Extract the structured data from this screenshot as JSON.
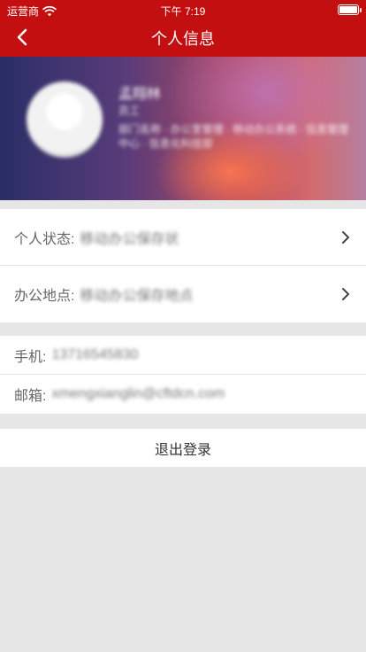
{
  "status": {
    "carrier": "运营商",
    "time": "下午 7:19"
  },
  "nav": {
    "title": "个人信息"
  },
  "profile": {
    "name": "孟翔林",
    "role": "员工",
    "department": "部门名称 · 办公室管理 · 移动办公系统 · 信息管理中心 · 信息化科技部"
  },
  "work_info": {
    "items": [
      {
        "label": "个人状态:",
        "value": "移动办公保存状"
      },
      {
        "label": "办公地点:",
        "value": "移动办公保存地点"
      }
    ]
  },
  "contact": {
    "phone_label": "手机:",
    "phone_value": "13716545830",
    "email_label": "邮箱:",
    "email_value": "xmengxianglin@cftdcn.com"
  },
  "actions": {
    "logout": "退出登录"
  },
  "colors": {
    "nav_bg": "#c40f10",
    "page_bg": "#e6e6e6"
  }
}
